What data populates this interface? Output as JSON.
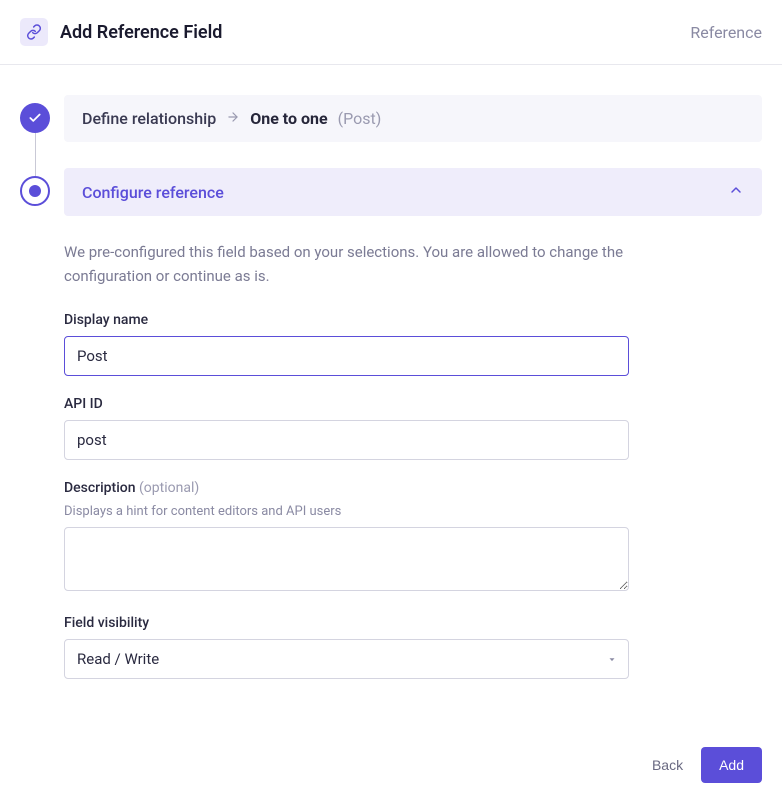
{
  "header": {
    "title": "Add Reference Field",
    "type_label": "Reference"
  },
  "steps": {
    "define": {
      "title": "Define relationship",
      "selection": "One to one",
      "model": "(Post)"
    },
    "configure": {
      "title": "Configure reference",
      "description": "We pre-configured this field based on your selections. You are allowed to change the configuration or continue as is."
    }
  },
  "form": {
    "display_name": {
      "label": "Display name",
      "value": "Post"
    },
    "api_id": {
      "label": "API ID",
      "value": "post"
    },
    "description": {
      "label": "Description",
      "optional": "(optional)",
      "hint": "Displays a hint for content editors and API users",
      "value": ""
    },
    "visibility": {
      "label": "Field visibility",
      "value": "Read / Write"
    }
  },
  "footer": {
    "back": "Back",
    "add": "Add"
  }
}
